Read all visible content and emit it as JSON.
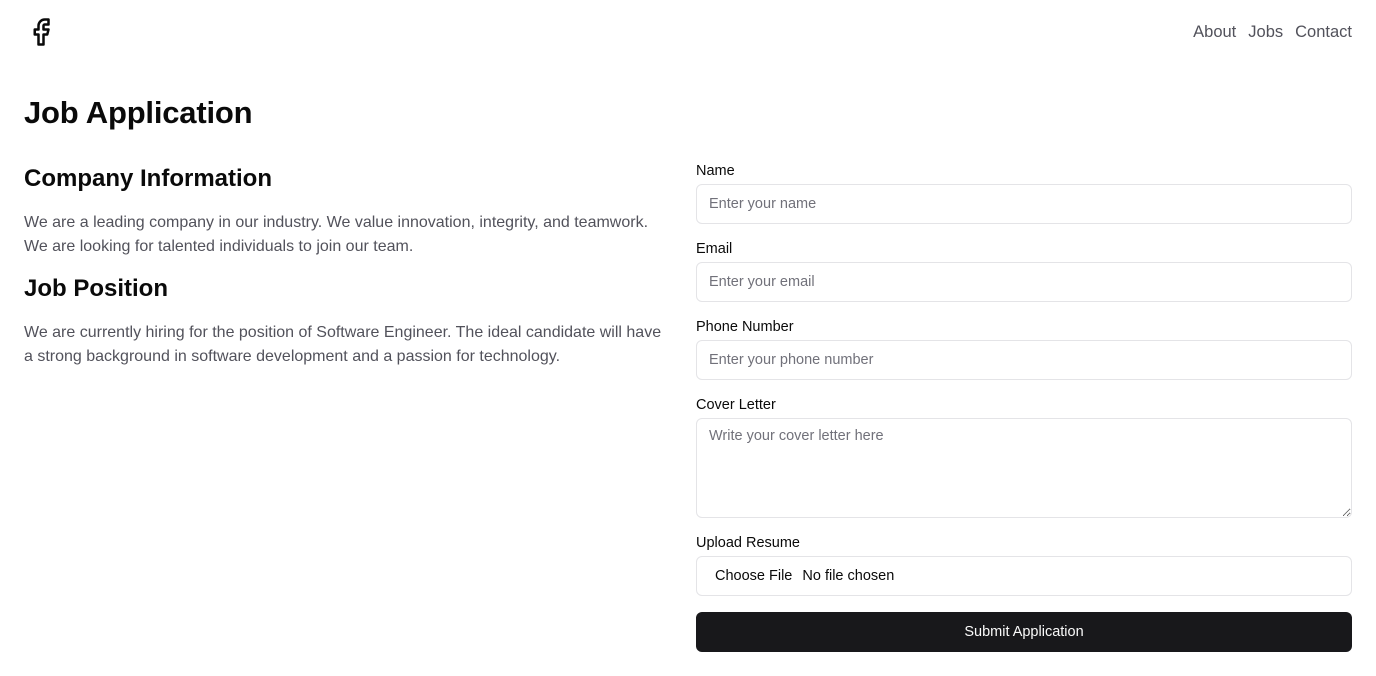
{
  "header": {
    "logo_icon": "facebook-icon",
    "nav": [
      "About",
      "Jobs",
      "Contact"
    ]
  },
  "page": {
    "title": "Job Application"
  },
  "company": {
    "heading": "Company Information",
    "text": "We are a leading company in our industry. We value innovation, integrity, and teamwork. We are looking for talented individuals to join our team."
  },
  "position": {
    "heading": "Job Position",
    "text": "We are currently hiring for the position of Software Engineer. The ideal candidate will have a strong background in software development and a passion for technology."
  },
  "form": {
    "name": {
      "label": "Name",
      "placeholder": "Enter your name"
    },
    "email": {
      "label": "Email",
      "placeholder": "Enter your email"
    },
    "phone": {
      "label": "Phone Number",
      "placeholder": "Enter your phone number"
    },
    "cover": {
      "label": "Cover Letter",
      "placeholder": "Write your cover letter here"
    },
    "resume": {
      "label": "Upload Resume",
      "button": "Choose File",
      "status": "No file chosen"
    },
    "submit": "Submit Application"
  },
  "colors": {
    "primary_button": "#18181b",
    "muted_text": "#52525b",
    "border": "#e4e4e7"
  }
}
